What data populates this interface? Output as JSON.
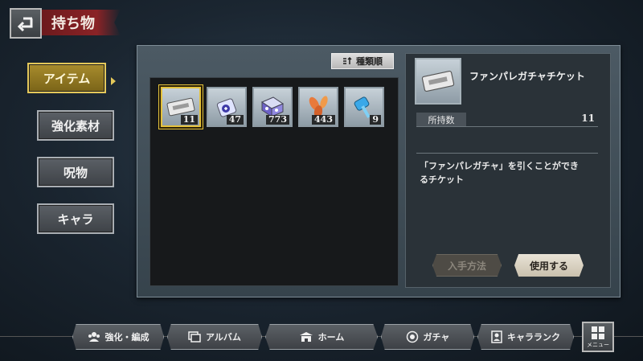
{
  "header": {
    "title": "持ち物"
  },
  "tabs": [
    {
      "label": "アイテム",
      "active": true
    },
    {
      "label": "強化素材",
      "active": false
    },
    {
      "label": "呪物",
      "active": false
    },
    {
      "label": "キャラ",
      "active": false
    }
  ],
  "sort_button": {
    "label": "種類順"
  },
  "items": [
    {
      "icon": "ticket-icon",
      "count": "11",
      "selected": true
    },
    {
      "icon": "potion-flask-icon",
      "count": "47",
      "selected": false
    },
    {
      "icon": "crystal-block-icon",
      "count": "773",
      "selected": false
    },
    {
      "icon": "leaves-icon",
      "count": "443",
      "selected": false
    },
    {
      "icon": "hammer-icon",
      "count": "9",
      "selected": false
    }
  ],
  "detail": {
    "name": "ファンパレガチャチケット",
    "owned_label": "所持数",
    "owned_value": "11",
    "description_line1": "「ファンパレガチャ」を引くことができ",
    "description_line2": "るチケット",
    "how_to_get_label": "入手方法",
    "use_label": "使用する"
  },
  "bottom_nav": [
    {
      "label": "強化・編成",
      "icon": "party-icon"
    },
    {
      "label": "アルバム",
      "icon": "album-icon"
    },
    {
      "label": "ホーム",
      "icon": "home-icon"
    },
    {
      "label": "ガチャ",
      "icon": "gacha-icon"
    },
    {
      "label": "キャラランク",
      "icon": "character-rank-icon"
    }
  ],
  "menu": {
    "label": "メニュー"
  },
  "colors": {
    "accent_gold": "#e5c23c",
    "title_red": "#8a2326"
  }
}
